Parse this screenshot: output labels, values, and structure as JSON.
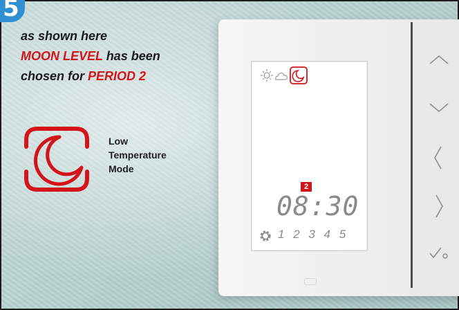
{
  "step": {
    "number": "5"
  },
  "caption": {
    "line1": "as shown here",
    "line2_emph": "MOON LEVEL",
    "line2_rest": " has been",
    "line3_rest": "chosen for ",
    "line3_emph": "PERIOD 2"
  },
  "mode": {
    "icon": "moon-icon",
    "label_line1": "Low",
    "label_line2": "Temperature",
    "label_line3": "Mode"
  },
  "display": {
    "icons": [
      "sun-icon",
      "cloud-icon",
      "moon-icon"
    ],
    "selected_icon": "moon-icon",
    "period": "2",
    "time": "08:30",
    "days": "1 2 3 4 5"
  },
  "buttons": [
    "up-arrow-icon",
    "down-arrow-icon",
    "left-arrow-icon",
    "right-arrow-icon",
    "confirm-icon"
  ],
  "colors": {
    "accent_red": "#d4141b",
    "step_blue": "#2f8fd0"
  }
}
